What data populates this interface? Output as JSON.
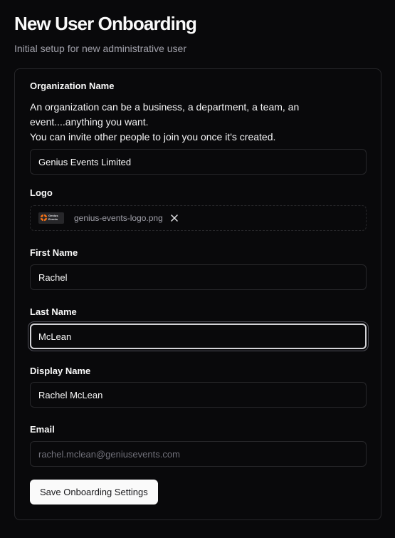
{
  "header": {
    "title": "New User Onboarding",
    "subtitle": "Initial setup for new administrative user"
  },
  "form": {
    "organization": {
      "label": "Organization Name",
      "description_line1": "An organization can be a business, a department, a team, an event....anything you want.",
      "description_line2": "You can invite other people to join you once it's created.",
      "value": "Genius Events Limited"
    },
    "logo": {
      "label": "Logo",
      "file_name": "genius-events-logo.png",
      "thumbnail_text": "Genius\nEvents",
      "remove_icon": "close-icon",
      "brand_color": "#f97316"
    },
    "first_name": {
      "label": "First Name",
      "value": "Rachel"
    },
    "last_name": {
      "label": "Last Name",
      "value": "McLean",
      "focused": true
    },
    "display_name": {
      "label": "Display Name",
      "value": "Rachel McLean"
    },
    "email": {
      "label": "Email",
      "placeholder": "rachel.mclean@geniusevents.com",
      "value": ""
    },
    "submit_label": "Save Onboarding Settings"
  },
  "theme": {
    "background": "#09090b",
    "border": "#27272a",
    "text": "#fafafa",
    "muted_text": "#a1a1aa",
    "primary_button": "#fafafa"
  }
}
